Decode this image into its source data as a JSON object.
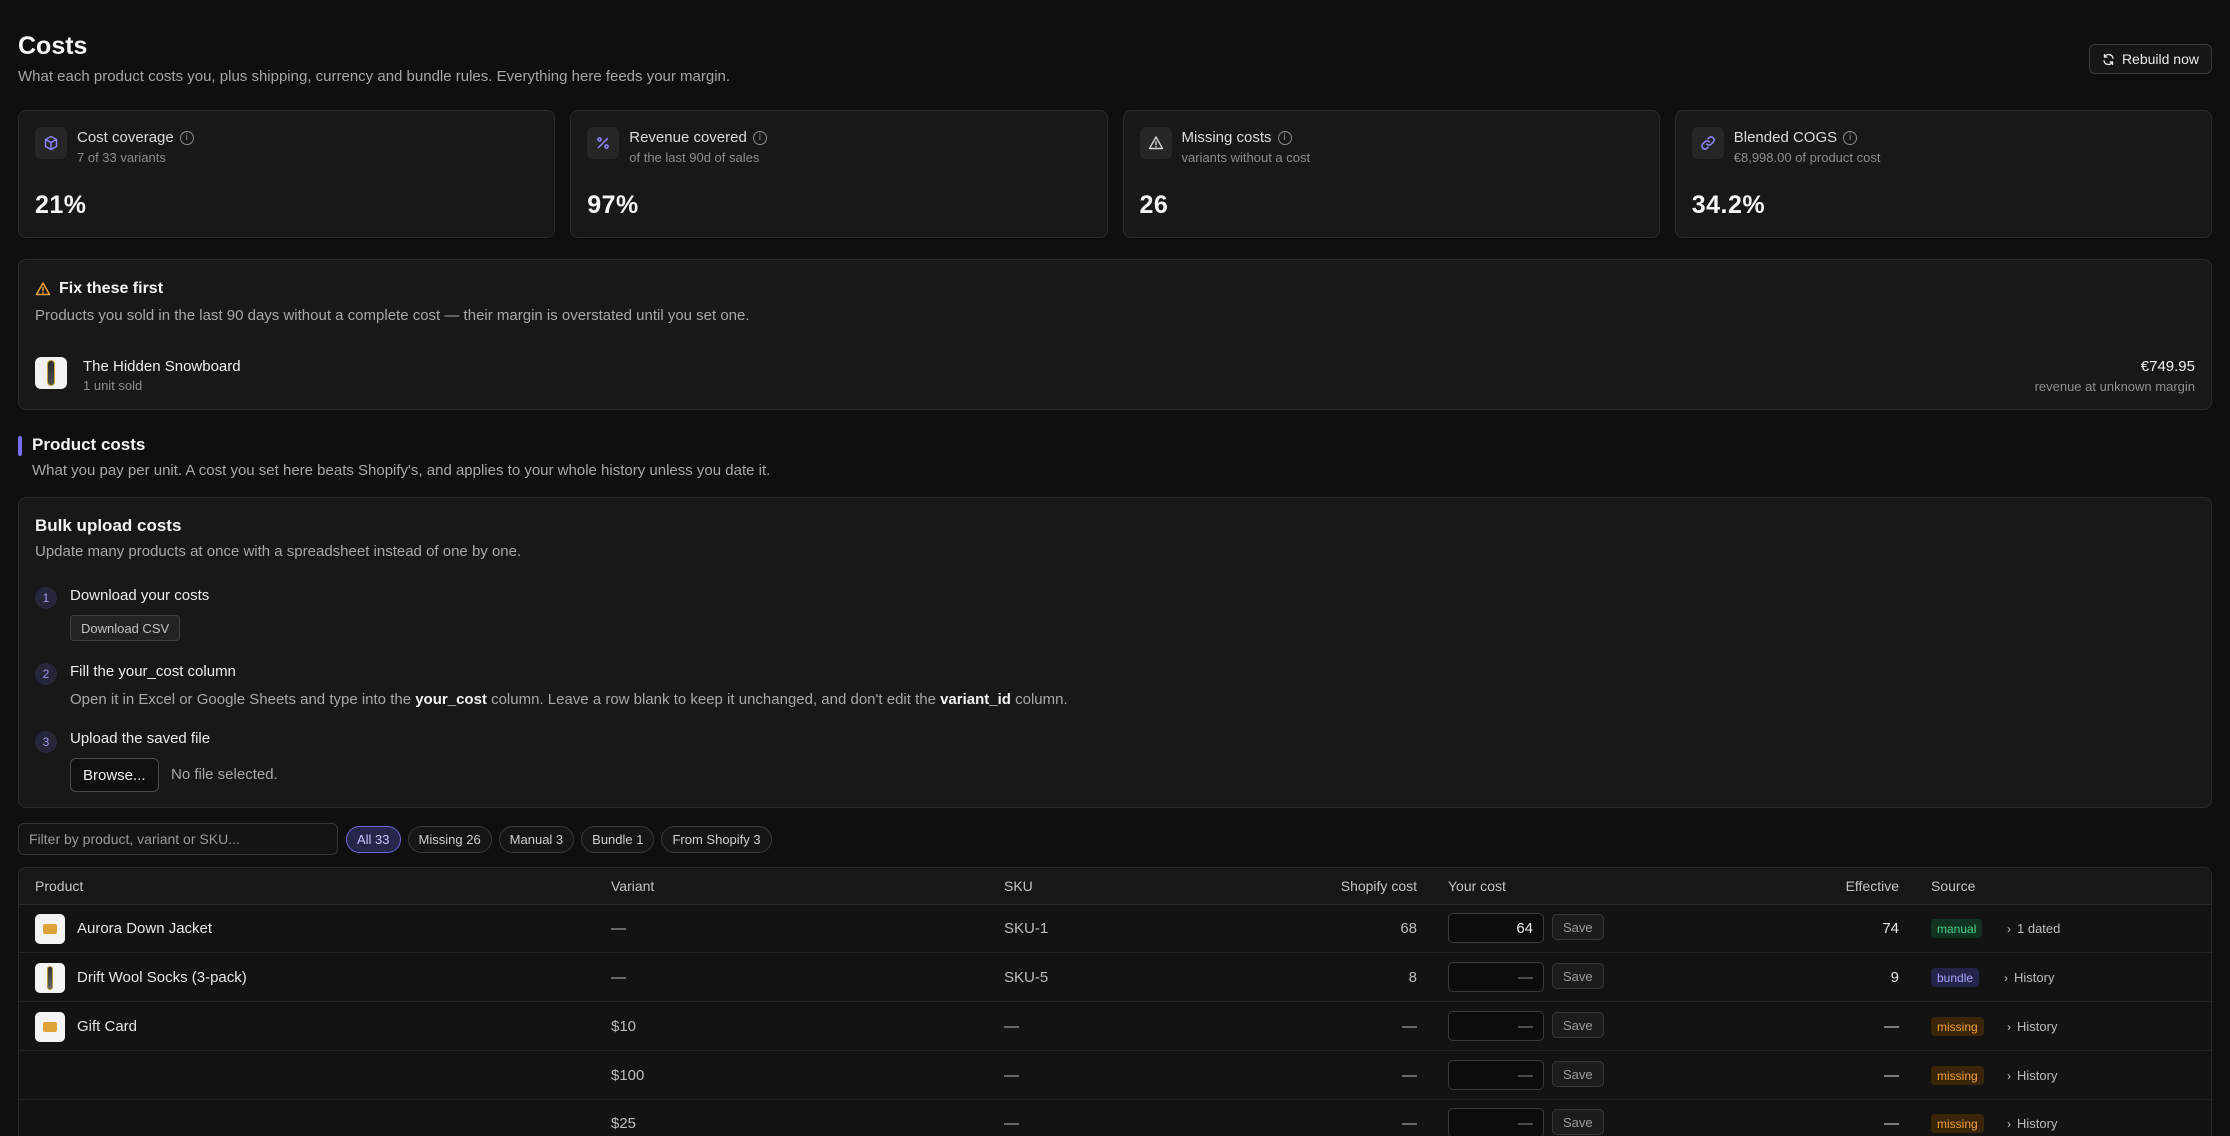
{
  "header": {
    "title": "Costs",
    "subtitle": "What each product costs you, plus shipping, currency and bundle rules. Everything here feeds your margin.",
    "rebuild_label": "Rebuild now"
  },
  "stats": [
    {
      "label": "Cost coverage",
      "sub": "7 of 33 variants",
      "value": "21%",
      "icon": "cube-icon"
    },
    {
      "label": "Revenue covered",
      "sub": "of the last 90d of sales",
      "value": "97%",
      "icon": "percent-icon"
    },
    {
      "label": "Missing costs",
      "sub": "variants without a cost",
      "value": "26",
      "icon": "warning-icon"
    },
    {
      "label": "Blended COGS",
      "sub": "€8,998.00 of product cost",
      "value": "34.2%",
      "icon": "link-icon"
    }
  ],
  "fix_first": {
    "title": "Fix these first",
    "description": "Products you sold in the last 90 days without a complete cost — their margin is overstated until you set one.",
    "item": {
      "name": "The Hidden Snowboard",
      "sold": "1 unit sold",
      "amount": "€749.95",
      "amount_sub": "revenue at unknown margin"
    }
  },
  "product_costs": {
    "title": "Product costs",
    "description": "What you pay per unit. A cost you set here beats Shopify's, and applies to your whole history unless you date it."
  },
  "bulk": {
    "title": "Bulk upload costs",
    "description": "Update many products at once with a spreadsheet instead of one by one.",
    "steps": [
      {
        "num": "1",
        "title": "Download your costs",
        "button": "Download CSV"
      },
      {
        "num": "2",
        "title": "Fill the your_cost column",
        "text_a": "Open it in Excel or Google Sheets and type into the ",
        "text_b": "your_cost",
        "text_c": " column. Leave a row blank to keep it unchanged, and don't edit the ",
        "text_d": "variant_id",
        "text_e": " column."
      },
      {
        "num": "3",
        "title": "Upload the saved file",
        "button": "Browse...",
        "status": "No file selected."
      }
    ]
  },
  "filter": {
    "placeholder": "Filter by product, variant or SKU...",
    "chips": [
      "All 33",
      "Missing 26",
      "Manual 3",
      "Bundle 1",
      "From Shopify 3"
    ],
    "active_chip": "All 33"
  },
  "table": {
    "columns": {
      "product": "Product",
      "variant": "Variant",
      "sku": "SKU",
      "shopify_cost": "Shopify cost",
      "your_cost": "Your cost",
      "effective": "Effective",
      "source": "Source"
    },
    "save_label": "Save",
    "rows": [
      {
        "product": "Aurora Down Jacket",
        "thumb": "card",
        "variant": "—",
        "sku": "SKU-1",
        "shopify_cost": "68",
        "your_cost": "64",
        "placeholder": "—",
        "effective": "74",
        "source": "manual",
        "history": "1 dated"
      },
      {
        "product": "Drift Wool Socks (3-pack)",
        "thumb": "sock",
        "variant": "—",
        "sku": "SKU-5",
        "shopify_cost": "8",
        "your_cost": "",
        "placeholder": "—",
        "effective": "9",
        "source": "bundle",
        "history": "History"
      },
      {
        "product": "Gift Card",
        "thumb": "card",
        "variant": "$10",
        "sku": "—",
        "shopify_cost": "—",
        "your_cost": "",
        "placeholder": "—",
        "effective": "—",
        "source": "missing",
        "history": "History"
      },
      {
        "product": "",
        "thumb": "",
        "variant": "$100",
        "sku": "—",
        "shopify_cost": "—",
        "your_cost": "",
        "placeholder": "—",
        "effective": "—",
        "source": "missing",
        "history": "History"
      },
      {
        "product": "",
        "thumb": "",
        "variant": "$25",
        "sku": "—",
        "shopify_cost": "—",
        "your_cost": "",
        "placeholder": "—",
        "effective": "—",
        "source": "missing",
        "history": "History"
      }
    ]
  },
  "colors": {
    "background": "#0f0f0f",
    "accent": "#7a6cf0",
    "manual": "#43d28a",
    "bundle": "#a8a4ff",
    "missing": "#f0a23c",
    "warning": "#f0a23c"
  }
}
